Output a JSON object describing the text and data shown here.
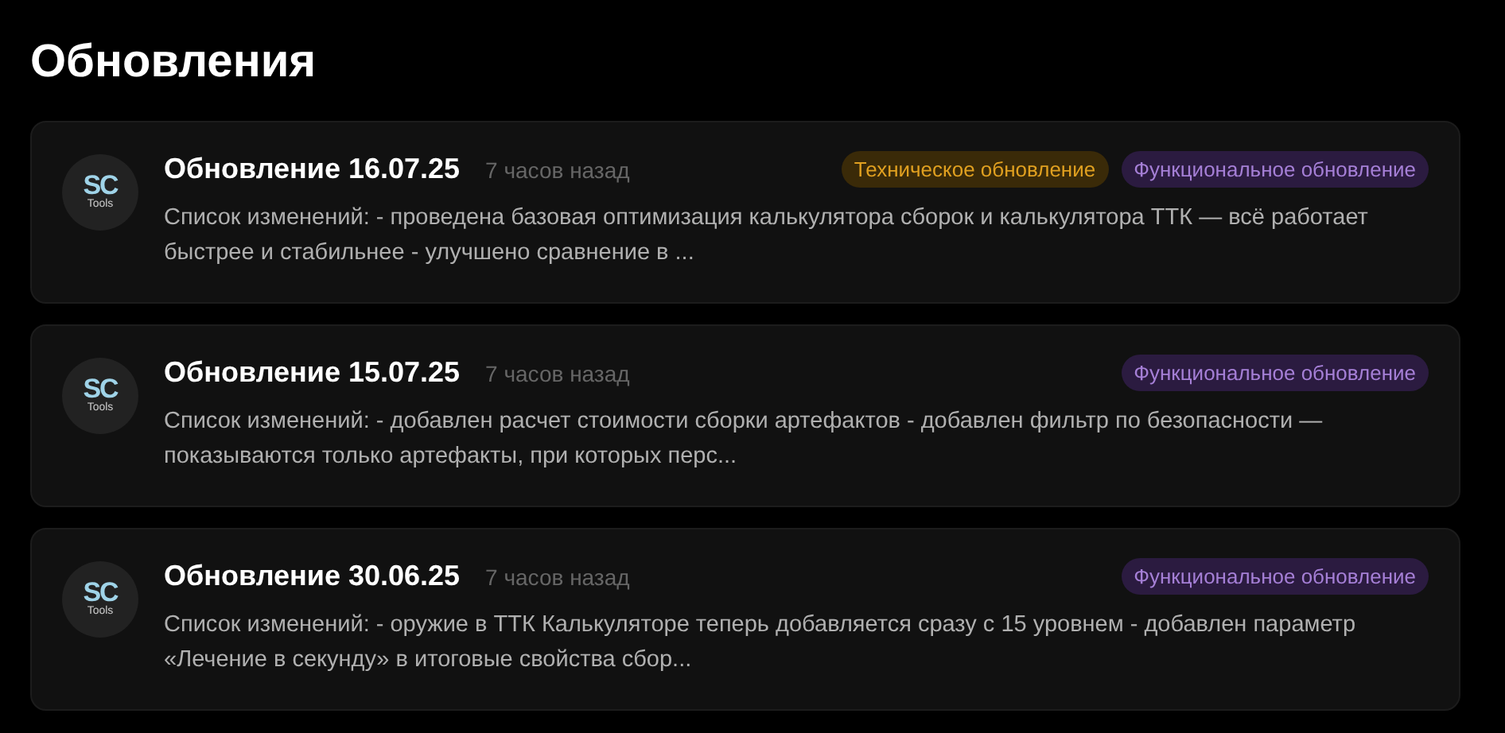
{
  "page": {
    "title": "Обновления"
  },
  "updates": [
    {
      "avatar": {
        "logo": "SC",
        "caption": "Tools"
      },
      "title": "Обновление 16.07.25",
      "time": "7 часов назад",
      "tags": [
        {
          "kind": "tech",
          "label": "Техническое обновление"
        },
        {
          "kind": "func",
          "label": "Функциональное обновление"
        }
      ],
      "text": "Список изменений: - проведена базовая оптимизация калькулятора сборок и калькулятора ТТК — всё работает быстрее и стабильнее - улучшено сравнение в ..."
    },
    {
      "avatar": {
        "logo": "SC",
        "caption": "Tools"
      },
      "title": "Обновление 15.07.25",
      "time": "7 часов назад",
      "tags": [
        {
          "kind": "func",
          "label": "Функциональное обновление"
        }
      ],
      "text": "Список изменений: - добавлен расчет стоимости сборки артефактов - добавлен фильтр по безопасности — показываются только артефакты, при которых перс..."
    },
    {
      "avatar": {
        "logo": "SC",
        "caption": "Tools"
      },
      "title": "Обновление 30.06.25",
      "time": "7 часов назад",
      "tags": [
        {
          "kind": "func",
          "label": "Функциональное обновление"
        }
      ],
      "text": "Список изменений: - оружие в ТТК Калькуляторе теперь добавляется сразу с 15 уровнем - добавлен параметр «Лечение в секунду» в итоговые свойства сбор..."
    }
  ]
}
